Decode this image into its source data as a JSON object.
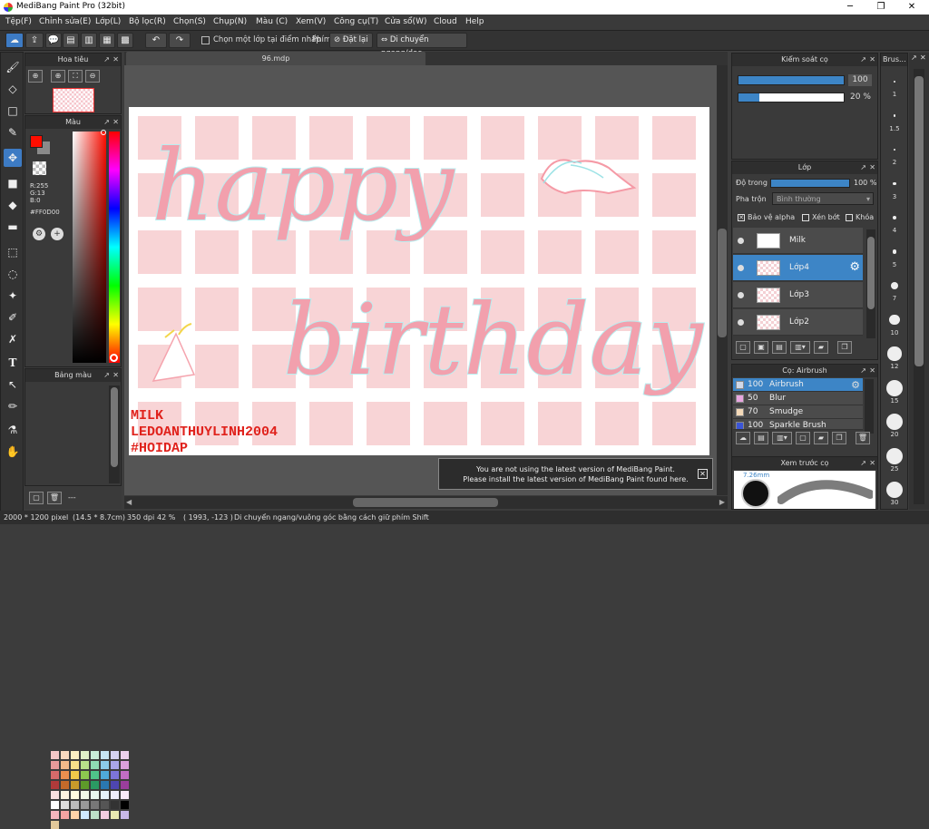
{
  "window": {
    "title": "MediBang Paint Pro (32bit)",
    "minimize": "─",
    "maximize": "❐",
    "close": "✕"
  },
  "menu": [
    "Tệp(F)",
    "Chỉnh sửa(E)",
    "Lớp(L)",
    "Bộ lọc(R)",
    "Chọn(S)",
    "Chụp(N)",
    "Màu (C)",
    "Xem(V)",
    "Công cụ(T)",
    "Cửa sổ(W)",
    "Cloud",
    "Help"
  ],
  "toolbar": {
    "select_one_layer": "Chọn một lớp tại điểm nhấp",
    "key_label": "Phím",
    "reset": "Đặt lại",
    "move_hv": "Di chuyển ngang/dọc"
  },
  "navigator": {
    "title": "Hoa tiêu"
  },
  "color_panel": {
    "title": "Màu",
    "r": "R:255",
    "g": "G:13",
    "b": "B:0",
    "hex": "#FF0D00",
    "primary_color": "#ff0d00",
    "secondary_color": "#8a8a8a"
  },
  "palette": {
    "title": "Bảng màu",
    "footer_text": "---"
  },
  "document": {
    "tab": "96.mdp"
  },
  "canvas": {
    "line1": "happy",
    "line2": "birthday",
    "credit1": "MILK",
    "credit2": "LEDOANTHUYLINH2004",
    "credit3": "#HOIDAP"
  },
  "brush_control": {
    "title": "Kiểm soát cọ",
    "size_value": "100",
    "size_level": 1.0,
    "opacity_value": "20 %",
    "opacity_level": 0.2
  },
  "layer_panel": {
    "title": "Lớp",
    "opacity_label": "Độ trong",
    "opacity_value": "100 %",
    "blend_label": "Pha trộn",
    "blend_value": "Bình thường",
    "protect_alpha": "Bảo vệ alpha",
    "clip": "Xén bớt",
    "lock": "Khóa",
    "layers": [
      {
        "name": "Milk",
        "selected": false
      },
      {
        "name": "Lớp4",
        "selected": true
      },
      {
        "name": "Lớp3",
        "selected": false
      },
      {
        "name": "Lớp2",
        "selected": false
      }
    ]
  },
  "brush_panel": {
    "title": "Cọ: Airbrush",
    "brushes": [
      {
        "size": "100",
        "name": "Airbrush",
        "color": "#cfd8e8",
        "selected": true
      },
      {
        "size": "50",
        "name": "Blur",
        "color": "#e9a6e0",
        "selected": false
      },
      {
        "size": "70",
        "name": "Smudge",
        "color": "#f4d9b8",
        "selected": false
      },
      {
        "size": "100",
        "name": "Sparkle Brush",
        "color": "#3b55d6",
        "selected": false
      }
    ]
  },
  "brush_preview": {
    "title": "Xem trước cọ",
    "size": "7.26mm"
  },
  "brush_size_strip": {
    "title": "Brus...",
    "sizes": [
      "1",
      "1.5",
      "2",
      "3",
      "4",
      "5",
      "7",
      "10",
      "12",
      "15",
      "20",
      "25",
      "30"
    ]
  },
  "notification": {
    "line1": "You are not using the latest version of MediBang Paint.",
    "line2": "Please install the latest version of MediBang Paint found here."
  },
  "status": {
    "size": "2000 * 1200 pixel",
    "cm": "(14.5 * 8.7cm)",
    "dpi": "350 dpi",
    "zoom": "42 %",
    "coords": "( 1993, -123 )",
    "hint": "Di chuyển ngang/vuông góc bằng cách giữ phím Shift"
  }
}
